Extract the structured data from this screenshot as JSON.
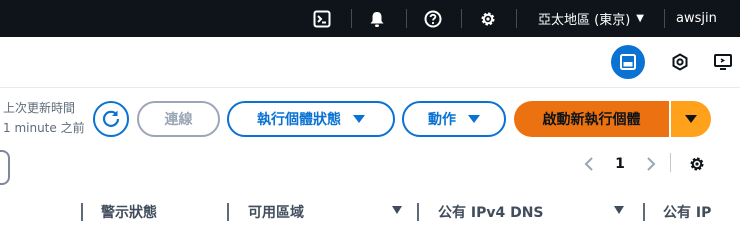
{
  "topnav": {
    "cloudshell_icon": "cloudshell-icon",
    "bell_icon": "bell-icon",
    "help_icon": "help-icon",
    "settings_icon": "gear-icon",
    "region_label": "亞太地區 (東京)",
    "user_label": "awsjin"
  },
  "toolbar2": {
    "icons": [
      "panel-icon",
      "hexagon-icon",
      "screen-share-icon"
    ]
  },
  "actions": {
    "last_updated_label": "上次更新時間",
    "last_updated_value": "1 minute 之前",
    "connect_label": "連線",
    "instance_state_label": "執行個體狀態",
    "actions_label": "動作",
    "launch_label": "啟動新執行個體"
  },
  "pagination": {
    "current_page": "1"
  },
  "table": {
    "columns": [
      "警示狀態",
      "可用區域",
      "公有 IPv4 DNS",
      "公有 IP"
    ]
  }
}
